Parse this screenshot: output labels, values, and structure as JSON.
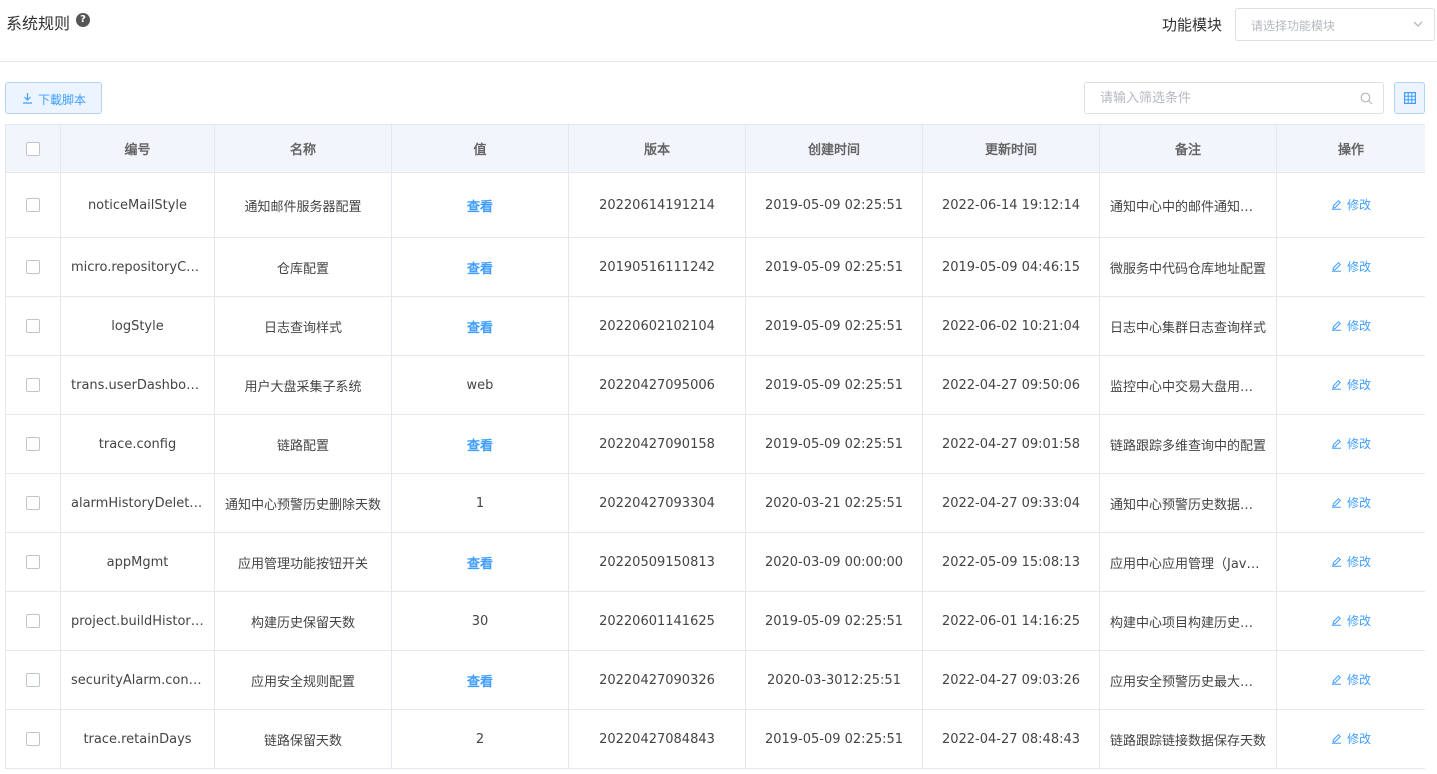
{
  "header": {
    "title": "系统规则",
    "help_glyph": "?",
    "module_label": "功能模块",
    "module_placeholder": "请选择功能模块"
  },
  "toolbar": {
    "download_label": "下載脚本",
    "filter_placeholder": "请输入筛选条件"
  },
  "table": {
    "columns": [
      "编号",
      "名称",
      "值",
      "版本",
      "创建时间",
      "更新时间",
      "备注",
      "操作"
    ],
    "edit_label": "修改",
    "rows": [
      {
        "id": "noticeMailStyle",
        "name": "通知邮件服务器配置",
        "value": "查看",
        "value_is_link": true,
        "version": "20220614191214",
        "created": "2019-05-09 02:25:51",
        "updated": "2022-06-14 19:12:14",
        "remark": "通知中心中的邮件通知服务器配置"
      },
      {
        "id": "micro.repositoryConfig",
        "name": "仓库配置",
        "value": "查看",
        "value_is_link": true,
        "version": "20190516111242",
        "created": "2019-05-09 02:25:51",
        "updated": "2019-05-09 04:46:15",
        "remark": "微服务中代码仓库地址配置"
      },
      {
        "id": "logStyle",
        "name": "日志查询样式",
        "value": "查看",
        "value_is_link": true,
        "version": "20220602102104",
        "created": "2019-05-09 02:25:51",
        "updated": "2022-06-02 10:21:04",
        "remark": "日志中心集群日志查询样式"
      },
      {
        "id": "trans.userDashboard",
        "name": "用户大盘采集子系统",
        "value": "web",
        "value_is_link": false,
        "version": "20220427095006",
        "created": "2019-05-09 02:25:51",
        "updated": "2022-04-27 09:50:06",
        "remark": "监控中心中交易大盘用户配置"
      },
      {
        "id": "trace.config",
        "name": "链路配置",
        "value": "查看",
        "value_is_link": true,
        "version": "20220427090158",
        "created": "2019-05-09 02:25:51",
        "updated": "2022-04-27 09:01:58",
        "remark": "链路跟踪多维查询中的配置"
      },
      {
        "id": "alarmHistoryDeleteDays",
        "name": "通知中心预警历史删除天数",
        "value": "1",
        "value_is_link": false,
        "version": "20220427093304",
        "created": "2020-03-21 02:25:51",
        "updated": "2022-04-27 09:33:04",
        "remark": "通知中心预警历史数据保留天数"
      },
      {
        "id": "appMgmt",
        "name": "应用管理功能按钮开关",
        "value": "查看",
        "value_is_link": true,
        "version": "20220509150813",
        "created": "2020-03-09 00:00:00",
        "updated": "2022-05-09 15:08:13",
        "remark": "应用中心应用管理（Java）按钮开关"
      },
      {
        "id": "project.buildHistoryDays",
        "name": "构建历史保留天数",
        "value": "30",
        "value_is_link": false,
        "version": "20220601141625",
        "created": "2019-05-09 02:25:51",
        "updated": "2022-06-01 14:16:25",
        "remark": "构建中心项目构建历史保留天数"
      },
      {
        "id": "securityAlarm.config",
        "name": "应用安全规则配置",
        "value": "查看",
        "value_is_link": true,
        "version": "20220427090326",
        "created": "2020-03-3012:25:51",
        "updated": "2022-04-27 09:03:26",
        "remark": "应用安全预警历史最大保留条数"
      },
      {
        "id": "trace.retainDays",
        "name": "链路保留天数",
        "value": "2",
        "value_is_link": false,
        "version": "20220427084843",
        "created": "2019-05-09 02:25:51",
        "updated": "2022-04-27 08:48:43",
        "remark": "链路跟踪链接数据保存天数"
      }
    ]
  }
}
